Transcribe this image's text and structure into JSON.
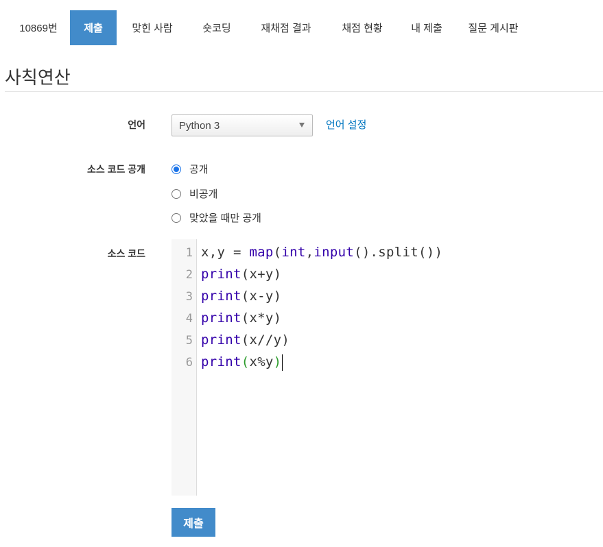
{
  "tabs": [
    {
      "label": "10869번"
    },
    {
      "label": "제출"
    },
    {
      "label": "맞힌 사람"
    },
    {
      "label": "숏코딩"
    },
    {
      "label": "재채점 결과"
    },
    {
      "label": "채점 현황"
    },
    {
      "label": "내 제출"
    },
    {
      "label": "질문 게시판"
    }
  ],
  "active_tab": "제출",
  "title": "사칙연산",
  "form": {
    "language_label": "언어",
    "language_value": "Python 3",
    "language_settings_link": "언어 설정",
    "visibility_label": "소스 코드 공개",
    "visibility_options": [
      "공개",
      "비공개",
      "맞았을 때만 공개"
    ],
    "visibility_selected": "공개",
    "source_label": "소스 코드",
    "submit_label": "제출"
  },
  "code": {
    "line_numbers": [
      "1",
      "2",
      "3",
      "4",
      "5",
      "6"
    ],
    "lines": [
      "x,y = map(int,input().split())",
      "print(x+y)",
      "print(x-y)",
      "print(x*y)",
      "print(x//y)",
      "print(x%y)"
    ]
  },
  "colors": {
    "accent": "#428bca",
    "link": "#0076c0",
    "keyword": "#3300aa",
    "matched_bracket": "#2c9c2c"
  }
}
